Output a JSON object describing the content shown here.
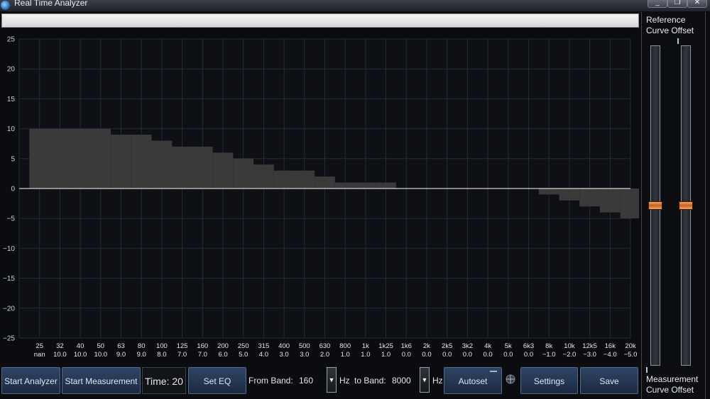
{
  "window": {
    "title": "Real Time Analyzer",
    "controls": [
      "_",
      "❐",
      "✕"
    ]
  },
  "right_panel": {
    "reference_label": "Reference\nCurve Offset",
    "measurement_label": "Measurement\nCurve Offset",
    "reference_offset": 0,
    "measurement_offset": 0
  },
  "toolbar": {
    "start_analyzer": "Start Analyzer",
    "start_measurement": "Start Measurement",
    "time_label": "Time:",
    "time_value": "20",
    "set_eq": "Set EQ",
    "from_band_label": "From Band:",
    "from_band_value": "160",
    "hz1": "Hz",
    "to_band_label": "to Band:",
    "to_band_value": "8000",
    "hz2": "Hz",
    "autoset": "Autoset",
    "settings": "Settings",
    "save": "Save"
  },
  "colors": {
    "background": "#0b0c10",
    "grid": "#262a35",
    "bars": "#3a3a3a",
    "zero_line": "#ffffff",
    "button": "#24364f",
    "slider_thumb": "#e07a35"
  },
  "chart_data": {
    "type": "bar",
    "ylim": [
      -25,
      25
    ],
    "yticks": [
      25,
      20,
      15,
      10,
      5,
      0,
      -5,
      -10,
      -15,
      -20,
      -25
    ],
    "categories": [
      "25",
      "32",
      "40",
      "50",
      "63",
      "80",
      "100",
      "125",
      "160",
      "200",
      "250",
      "315",
      "400",
      "500",
      "630",
      "800",
      "1k",
      "1k25",
      "1k6",
      "2k",
      "2k5",
      "3k2",
      "4k",
      "5k",
      "6k3",
      "8k",
      "10k",
      "12k5",
      "16k",
      "20k"
    ],
    "value_labels": [
      "nan",
      "10.0",
      "10.0",
      "10.0",
      "9.0",
      "9.0",
      "8.0",
      "7.0",
      "7.0",
      "6.0",
      "5.0",
      "4.0",
      "3.0",
      "3.0",
      "2.0",
      "1.0",
      "1.0",
      "1.0",
      "0.0",
      "0.0",
      "0.0",
      "0.0",
      "0.0",
      "0.0",
      "0.0",
      "−1.0",
      "−2.0",
      "−3.0",
      "−4.0",
      "−5.0"
    ],
    "values": [
      10,
      10,
      10,
      10,
      9,
      9,
      8,
      7,
      7,
      6,
      5,
      4,
      3,
      3,
      2,
      1,
      1,
      1,
      0,
      0,
      0,
      0,
      0,
      0,
      0,
      -1,
      -2,
      -3,
      -4,
      -5
    ],
    "grid": true
  }
}
